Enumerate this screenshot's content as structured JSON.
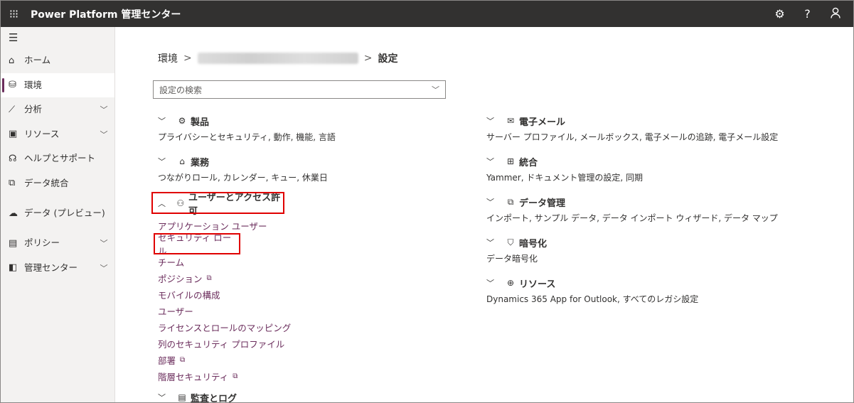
{
  "app": {
    "title": "Power Platform 管理センター"
  },
  "topbar": {
    "settings_icon": "gear-icon",
    "help_label": "?",
    "account_icon": "person-icon"
  },
  "sidebar": {
    "items": [
      {
        "label": "ホーム",
        "icon": "home-icon",
        "expandable": false,
        "active": false
      },
      {
        "label": "環境",
        "icon": "environment-icon",
        "expandable": false,
        "active": true
      },
      {
        "label": "分析",
        "icon": "chart-icon",
        "expandable": true,
        "active": false
      },
      {
        "label": "リソース",
        "icon": "resources-icon",
        "expandable": true,
        "active": false
      },
      {
        "label": "ヘルプとサポート",
        "icon": "headset-icon",
        "expandable": false,
        "active": false
      },
      {
        "label": "データ統合",
        "icon": "data-integration-icon",
        "expandable": false,
        "active": false
      },
      {
        "label": "データ (プレビュー)",
        "icon": "cloud-data-icon",
        "expandable": false,
        "active": false
      },
      {
        "label": "ポリシー",
        "icon": "policy-icon",
        "expandable": true,
        "active": false
      },
      {
        "label": "管理センター",
        "icon": "admin-center-icon",
        "expandable": true,
        "active": false
      }
    ]
  },
  "breadcrumb": {
    "root": "環境",
    "current": "設定"
  },
  "search": {
    "placeholder": "設定の検索"
  },
  "left_sections": [
    {
      "title": "製品",
      "icon": "gear-icon",
      "expanded": false,
      "desc": "プライバシーとセキュリティ, 動作, 機能, 言語"
    },
    {
      "title": "業務",
      "icon": "business-icon",
      "expanded": false,
      "desc": "つながりロール, カレンダー, キュー, 休業日"
    },
    {
      "title": "ユーザーとアクセス許可",
      "icon": "users-permissions-icon",
      "expanded": true,
      "links": [
        {
          "label": "アプリケーション ユーザー",
          "external": false
        },
        {
          "label": "セキュリティ ロール",
          "external": false
        },
        {
          "label": "チーム",
          "external": false
        },
        {
          "label": "ポジション",
          "external": true
        },
        {
          "label": "モバイルの構成",
          "external": false
        },
        {
          "label": "ユーザー",
          "external": false
        },
        {
          "label": "ライセンスとロールのマッピング",
          "external": false
        },
        {
          "label": "列のセキュリティ プロファイル",
          "external": false
        },
        {
          "label": "部署",
          "external": true
        },
        {
          "label": "階層セキュリティ",
          "external": true
        }
      ]
    },
    {
      "title": "監査とログ",
      "icon": "audit-icon",
      "expanded": false
    }
  ],
  "right_sections": [
    {
      "title": "電子メール",
      "icon": "mail-icon",
      "desc": "サーバー プロファイル, メールボックス, 電子メールの追跡, 電子メール設定"
    },
    {
      "title": "統合",
      "icon": "windows-icon",
      "desc": "Yammer, ドキュメント管理の設定, 同期"
    },
    {
      "title": "データ管理",
      "icon": "data-management-icon",
      "desc": "インポート, サンプル データ, データ インポート ウィザード, データ マップ"
    },
    {
      "title": "暗号化",
      "icon": "shield-icon",
      "desc": "データ暗号化"
    },
    {
      "title": "リソース",
      "icon": "globe-icon",
      "desc": "Dynamics 365 App for Outlook, すべてのレガシ設定"
    }
  ],
  "colors": {
    "accent": "#6b2d5c",
    "highlight": "#e00000",
    "topbar": "#323130"
  }
}
